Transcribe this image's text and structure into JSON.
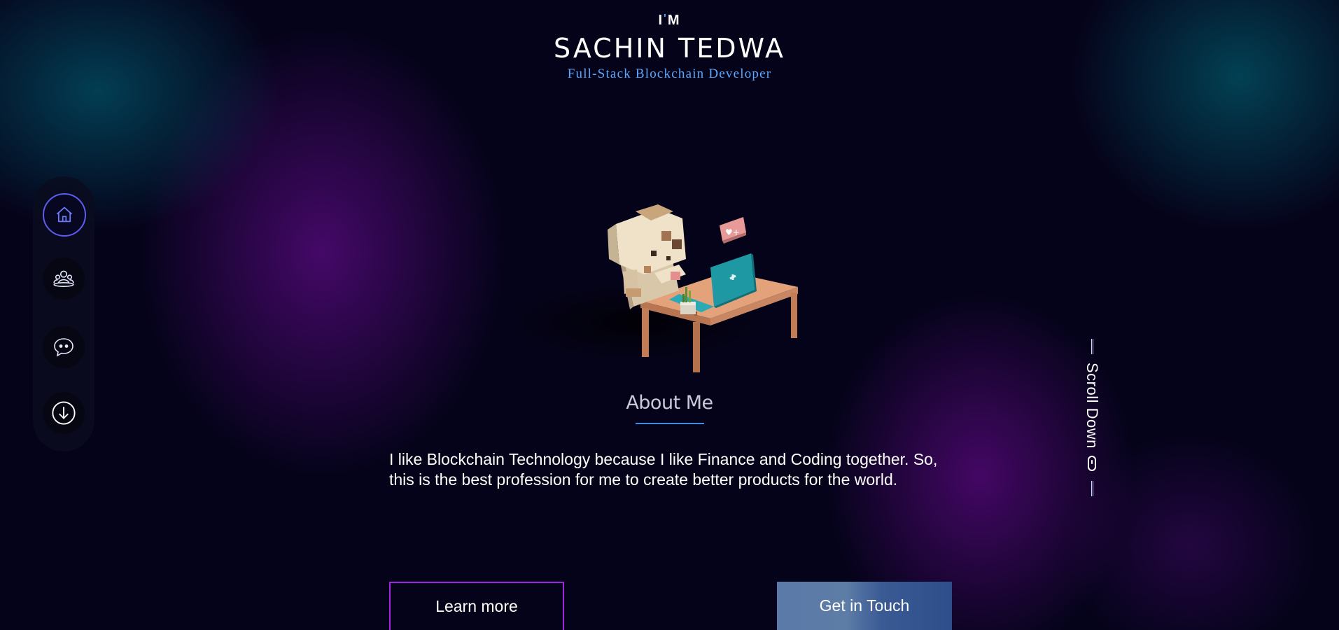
{
  "header": {
    "intro": "I",
    "intro_tick": "'",
    "intro_m": "M",
    "name": "SACHIN TEDWA",
    "subtitle": "Full-Stack Blockchain Developer"
  },
  "sidenav": {
    "items": [
      {
        "name": "home",
        "icon": "home-icon",
        "active": true
      },
      {
        "name": "about",
        "icon": "users-icon",
        "active": false
      },
      {
        "name": "contact",
        "icon": "chat-icon",
        "active": false
      },
      {
        "name": "scroll",
        "icon": "arrow-down-circle-icon",
        "active": false
      }
    ]
  },
  "about": {
    "title": "About Me",
    "text": "I like Blockchain Technology because I like Finance and Coding together. So, this is the best profession for me to create better products for the world."
  },
  "scroll_hint": {
    "label": "Scroll Down"
  },
  "buttons": {
    "learn_more": "Learn more",
    "get_in_touch": "Get in Touch"
  },
  "colors": {
    "accent_blue": "#5aa9ff",
    "accent_purple": "#a523e0",
    "nav_active": "#5d5cf0",
    "background": "#05031a"
  }
}
